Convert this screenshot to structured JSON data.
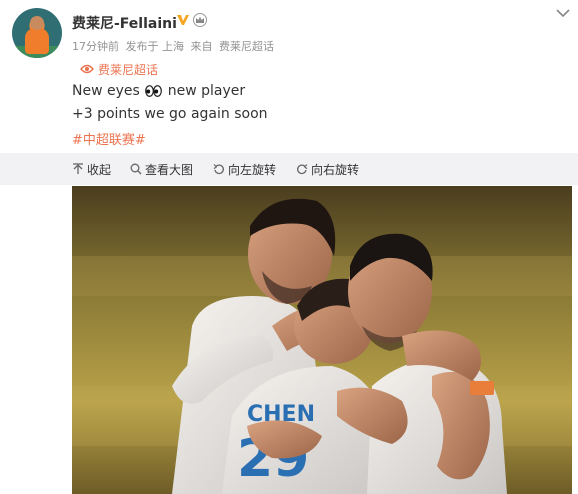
{
  "post": {
    "username": "费莱尼-Fellaini",
    "meta": {
      "time": "17分钟前",
      "posted_in": "发布于 上海",
      "source_prefix": "来自",
      "source": "费莱尼超话"
    },
    "topic_link": "费莱尼超话",
    "text_line1_before": "New eyes",
    "text_line1_after": "new player",
    "text_line2": "+3 points we go again soon",
    "hashtag": "#中超联赛#",
    "accent_color": "#eb7350"
  },
  "toolbar": {
    "collapse": "收起",
    "view_large": "查看大图",
    "rotate_left": "向左旋转",
    "rotate_right": "向右旋转"
  },
  "photo": {
    "jersey_text": "CHEN",
    "jersey_number": "29"
  },
  "icons": [
    "verified-v-icon",
    "crown-icon",
    "chevron-down-icon",
    "topic-icon",
    "eyes-emoji-icon",
    "collapse-arrow-icon",
    "magnify-icon",
    "rotate-left-icon",
    "rotate-right-icon"
  ]
}
